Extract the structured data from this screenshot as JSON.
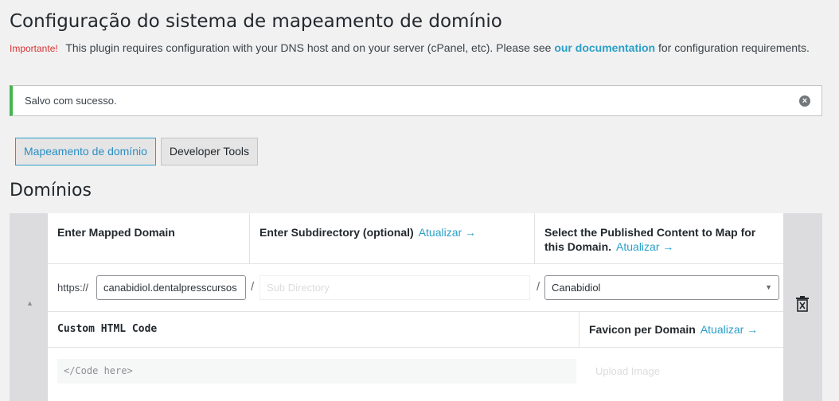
{
  "page": {
    "title": "Configuração do sistema de mapeamento de domínio"
  },
  "notice": {
    "important_label": "Importante!",
    "text_before": "This plugin requires configuration with your DNS host and on your server (cPanel, etc). Please see",
    "link_text": "our documentation",
    "text_after": "for configuration requirements."
  },
  "success": {
    "message": "Salvo com sucesso."
  },
  "tabs": [
    {
      "label": "Mapeamento de domínio",
      "active": true
    },
    {
      "label": "Developer Tools",
      "active": false
    }
  ],
  "domains": {
    "title": "Domínios",
    "headers": {
      "mapped_domain": "Enter Mapped Domain",
      "subdirectory": "Enter Subdirectory (optional)",
      "subdirectory_link": "Atualizar →",
      "published_content": "Select the Published Content to Map for this Domain.",
      "published_content_link": "Atualizar →"
    },
    "row": {
      "protocol": "https://",
      "domain_value": "canabidiol.dentalpresscursos",
      "slash": "/",
      "subdir_placeholder": "Sub Directory",
      "selected_content": "Canabidiol"
    },
    "custom": {
      "html_code_label": "Custom HTML Code",
      "favicon_label": "Favicon per Domain",
      "favicon_link": "Atualizar →",
      "code_placeholder": "</Code here>",
      "upload_label": "Upload Image"
    }
  },
  "icons": {
    "dismiss": "close-circle-icon",
    "collapse": "triangle-up-icon",
    "delete": "trash-icon",
    "select_caret": "caret-down-icon"
  },
  "colors": {
    "accent": "#2a9fc9",
    "success": "#46b450",
    "important": "#dc3232"
  }
}
